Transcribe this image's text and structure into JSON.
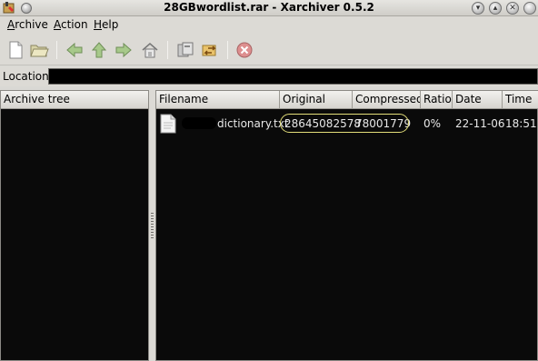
{
  "window": {
    "title": "28GBwordlist.rar - Xarchiver 0.5.2"
  },
  "menubar": {
    "items": [
      {
        "label": "Archive"
      },
      {
        "label": "Action"
      },
      {
        "label": "Help"
      }
    ]
  },
  "toolbar": {
    "buttons": [
      "new-archive-icon",
      "open-archive-icon",
      "back-icon",
      "up-icon",
      "forward-icon",
      "home-icon",
      "extract-icon",
      "convert-icon",
      "stop-icon"
    ]
  },
  "location": {
    "label": "Location:",
    "value": ""
  },
  "archive_tree": {
    "header": "Archive tree"
  },
  "file_list": {
    "columns": [
      "Filename",
      "Original",
      "Compressed",
      "Ratio",
      "Date",
      "Time"
    ],
    "rows": [
      {
        "filename": "dictionary.txt",
        "original": "28645082578",
        "compressed": "78001779",
        "ratio": "0%",
        "date": "22-11-06",
        "time": "18:51"
      }
    ]
  },
  "colors": {
    "pane_bg": "#0a0a0a",
    "chrome_bg": "#dcdad5",
    "highlight": "#e3de7a"
  }
}
